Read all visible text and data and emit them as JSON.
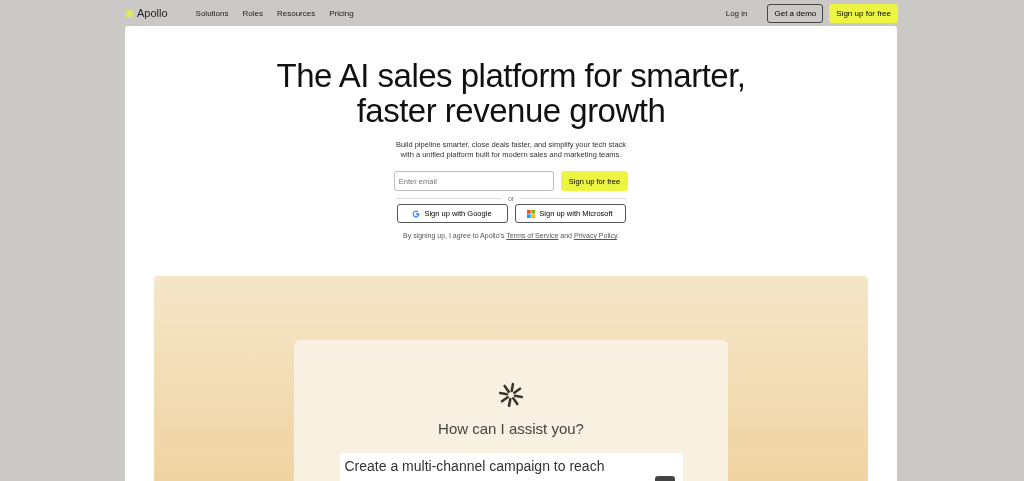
{
  "nav": {
    "brand": "Apollo",
    "links": [
      "Solutions",
      "Roles",
      "Resources",
      "Pricing"
    ],
    "login": "Log in",
    "demo": "Get a demo",
    "signup": "Sign up for free"
  },
  "hero": {
    "title": "The AI sales platform for smarter, faster revenue growth",
    "subtitle": "Build pipeline smarter, close deals faster, and simplify your tech stack with a unified platform built for modern sales and marketing teams.",
    "email": {
      "placeholder": "Enter email"
    },
    "submit": "Sign up for free",
    "divider": "or",
    "providers": [
      {
        "kind": "google",
        "label": "Sign up with Google"
      },
      {
        "kind": "microsoft",
        "label": "Sign up with Microsoft"
      }
    ],
    "legal": [
      {
        "kind": "text",
        "text": "By signing up, I agree to Apollo's "
      },
      {
        "kind": "link",
        "text": "Terms of Service"
      },
      {
        "kind": "text",
        "text": " and "
      },
      {
        "kind": "link",
        "text": "Privacy Policy"
      },
      {
        "kind": "text",
        "text": "."
      }
    ]
  },
  "assistant": {
    "question": "How can I assist you?",
    "prompt": "Create a multi-channel campaign to reach"
  }
}
